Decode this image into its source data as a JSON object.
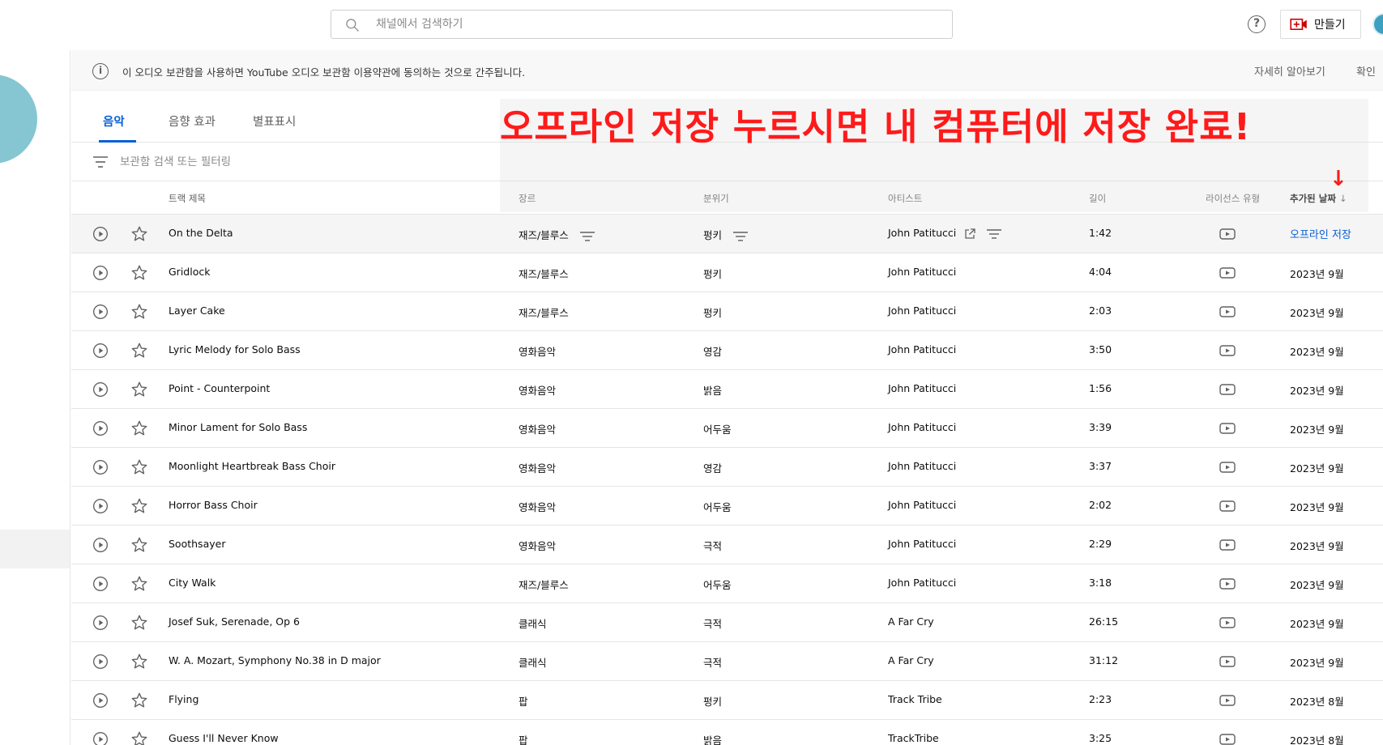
{
  "header": {
    "search_placeholder": "채널에서 검색하기",
    "help_label": "?",
    "create_label": "만들기"
  },
  "notice": {
    "text": "이 오디오 보관함을 사용하면 YouTube 오디오 보관함 이용약관에 동의하는 것으로 간주됩니다.",
    "learn_more": "자세히 알아보기",
    "confirm": "확인"
  },
  "tabs": [
    {
      "label": "음악",
      "active": true
    },
    {
      "label": "음향 효과",
      "active": false
    },
    {
      "label": "별표표시",
      "active": false
    }
  ],
  "filter": {
    "placeholder": "보관함 검색 또는 필터링"
  },
  "annotation": {
    "text": "오프라인 저장 누르시면 내 컴퓨터에 저장 완료!",
    "arrow": "↓",
    "color": "#ff1a1a"
  },
  "columns": {
    "title": "트랙 제목",
    "genre": "장르",
    "mood": "분위기",
    "artist": "아티스트",
    "length": "길이",
    "license": "라이선스 유형",
    "added": "추가된 날짜",
    "sort_arrow": "↓"
  },
  "rows": [
    {
      "title": "On the Delta",
      "genre": "재즈/블루스",
      "mood": "펑키",
      "artist": "John Patitucci",
      "length": "1:42",
      "added": "오프라인 저장",
      "hover": true
    },
    {
      "title": "Gridlock",
      "genre": "재즈/블루스",
      "mood": "펑키",
      "artist": "John Patitucci",
      "length": "4:04",
      "added": "2023년 9월"
    },
    {
      "title": "Layer Cake",
      "genre": "재즈/블루스",
      "mood": "펑키",
      "artist": "John Patitucci",
      "length": "2:03",
      "added": "2023년 9월"
    },
    {
      "title": "Lyric Melody for Solo Bass",
      "genre": "영화음악",
      "mood": "영감",
      "artist": "John Patitucci",
      "length": "3:50",
      "added": "2023년 9월"
    },
    {
      "title": "Point - Counterpoint",
      "genre": "영화음악",
      "mood": "밝음",
      "artist": "John Patitucci",
      "length": "1:56",
      "added": "2023년 9월"
    },
    {
      "title": "Minor Lament for Solo Bass",
      "genre": "영화음악",
      "mood": "어두움",
      "artist": "John Patitucci",
      "length": "3:39",
      "added": "2023년 9월"
    },
    {
      "title": "Moonlight Heartbreak Bass Choir",
      "genre": "영화음악",
      "mood": "영감",
      "artist": "John Patitucci",
      "length": "3:37",
      "added": "2023년 9월"
    },
    {
      "title": "Horror Bass Choir",
      "genre": "영화음악",
      "mood": "어두움",
      "artist": "John Patitucci",
      "length": "2:02",
      "added": "2023년 9월"
    },
    {
      "title": "Soothsayer",
      "genre": "영화음악",
      "mood": "극적",
      "artist": "John Patitucci",
      "length": "2:29",
      "added": "2023년 9월"
    },
    {
      "title": "City Walk",
      "genre": "재즈/블루스",
      "mood": "어두움",
      "artist": "John Patitucci",
      "length": "3:18",
      "added": "2023년 9월"
    },
    {
      "title": "Josef Suk, Serenade, Op 6",
      "genre": "클래식",
      "mood": "극적",
      "artist": "A Far Cry",
      "length": "26:15",
      "added": "2023년 9월"
    },
    {
      "title": "W. A. Mozart, Symphony No.38 in D major",
      "genre": "클래식",
      "mood": "극적",
      "artist": "A Far Cry",
      "length": "31:12",
      "added": "2023년 9월"
    },
    {
      "title": "Flying",
      "genre": "팝",
      "mood": "펑키",
      "artist": "Track Tribe",
      "length": "2:23",
      "added": "2023년 8월"
    },
    {
      "title": "Guess I'll Never Know",
      "genre": "팝",
      "mood": "밝음",
      "artist": "TrackTribe",
      "length": "3:25",
      "added": "2023년 8월"
    }
  ],
  "colors": {
    "accent": "#065fd4",
    "annotation": "#ff1a1a"
  }
}
